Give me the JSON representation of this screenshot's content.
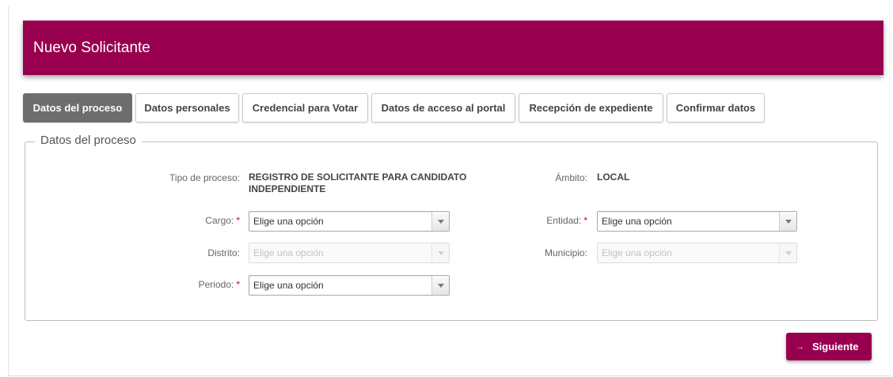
{
  "header": {
    "title": "Nuevo Solicitante"
  },
  "tabs": [
    {
      "label": "Datos del proceso",
      "active": true
    },
    {
      "label": "Datos personales",
      "active": false
    },
    {
      "label": "Credencial para Votar",
      "active": false
    },
    {
      "label": "Datos de acceso al portal",
      "active": false
    },
    {
      "label": "Recepción de expediente",
      "active": false
    },
    {
      "label": "Confirmar datos",
      "active": false
    }
  ],
  "section": {
    "legend": "Datos del proceso"
  },
  "form": {
    "tipo_proceso": {
      "label": "Tipo de proceso:",
      "value_line1": "REGISTRO DE SOLICITANTE PARA CANDIDATO",
      "value_line2": "INDEPENDIENTE"
    },
    "ambito": {
      "label": "Ámbito:",
      "value": "LOCAL"
    },
    "cargo": {
      "label": "Cargo:",
      "required_mark": "*",
      "value": "Elige una opción",
      "disabled": false
    },
    "entidad": {
      "label": "Entidad:",
      "required_mark": "*",
      "value": "Elige una opción",
      "disabled": false
    },
    "distrito": {
      "label": "Distrito:",
      "value": "Elige una opción",
      "disabled": true
    },
    "municipio": {
      "label": "Municipio:",
      "value": "Elige una opción",
      "disabled": true
    },
    "periodo": {
      "label": "Periodo:",
      "required_mark": "*",
      "value": "Elige una opción",
      "disabled": false
    }
  },
  "actions": {
    "next_label": "Siguiente",
    "next_icon": "arrow-right-icon"
  },
  "colors": {
    "brand": "#98004f",
    "active_tab": "#6f6c6d",
    "required": "#c0003a"
  }
}
